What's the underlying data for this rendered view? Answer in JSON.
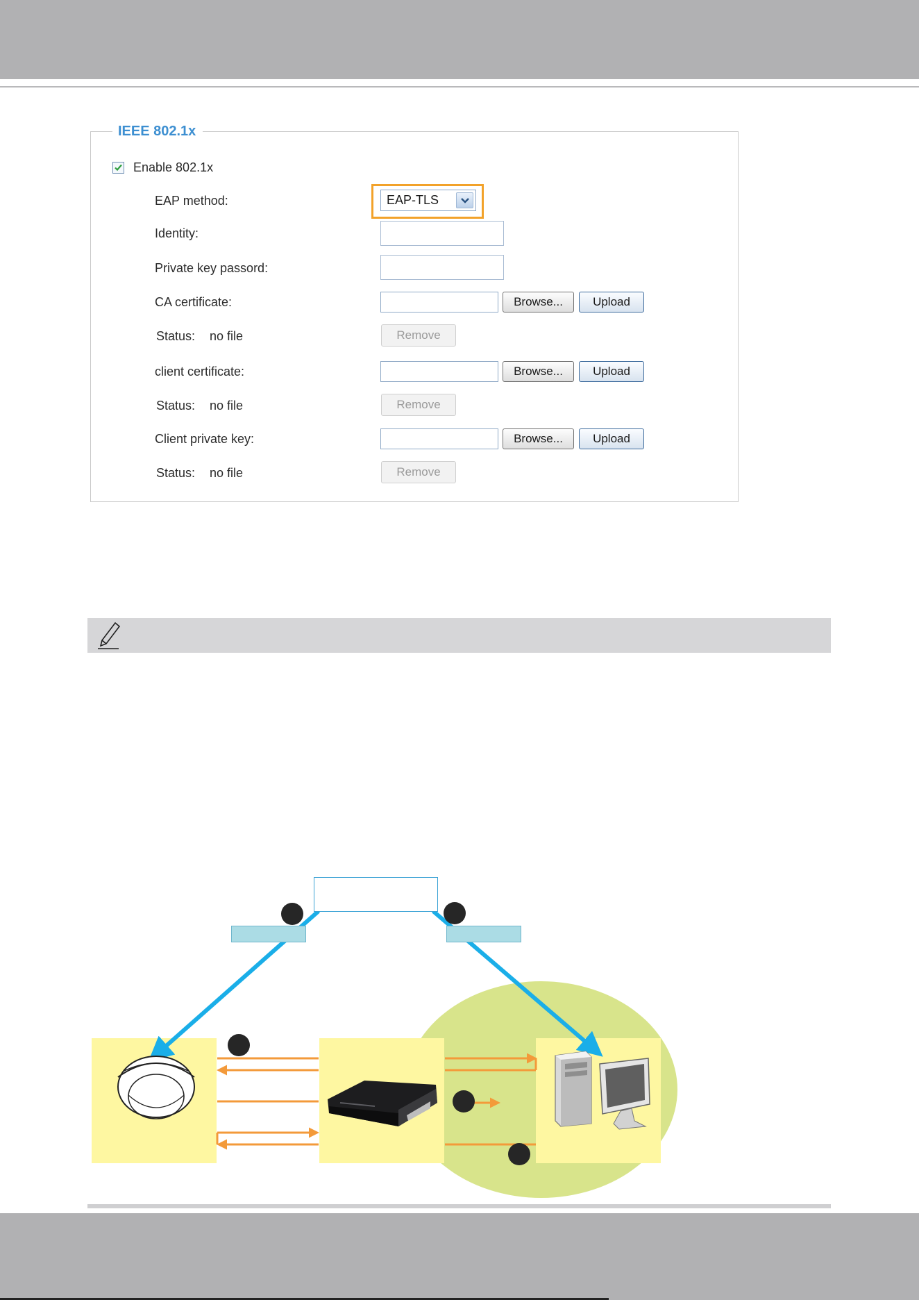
{
  "ieee8021x": {
    "legend": "IEEE 802.1x",
    "enable_label": "Enable 802.1x",
    "enable_checked": true,
    "eap_method_label": "EAP method:",
    "eap_method_value": "EAP-TLS",
    "identity_label": "Identity:",
    "identity_value": "",
    "private_key_password_label": "Private key passord:",
    "private_key_password_value": "",
    "ca_certificate_label": "CA certificate:",
    "ca_status_label": "Status:",
    "ca_status_value": "no file",
    "client_certificate_label": "client certificate:",
    "client_status_label": "Status:",
    "client_status_value": "no file",
    "client_private_key_label": "Client private key:",
    "key_status_label": "Status:",
    "key_status_value": "no file",
    "browse_label": "Browse...",
    "upload_label": "Upload",
    "remove_label": "Remove"
  },
  "colors": {
    "banner": "#b1b1b3",
    "legend_text": "#3d8fd1",
    "highlight": "#f2a22a",
    "diagram_box": "#fef7a1",
    "network_cloud": "#d8e48b",
    "blue_arrow": "#1aaee8",
    "orange_arrow": "#f39a3a"
  },
  "icons": {
    "note": "pencil-icon",
    "camera": "dome-camera-icon",
    "switch": "network-switch-icon",
    "server": "computer-icon"
  }
}
